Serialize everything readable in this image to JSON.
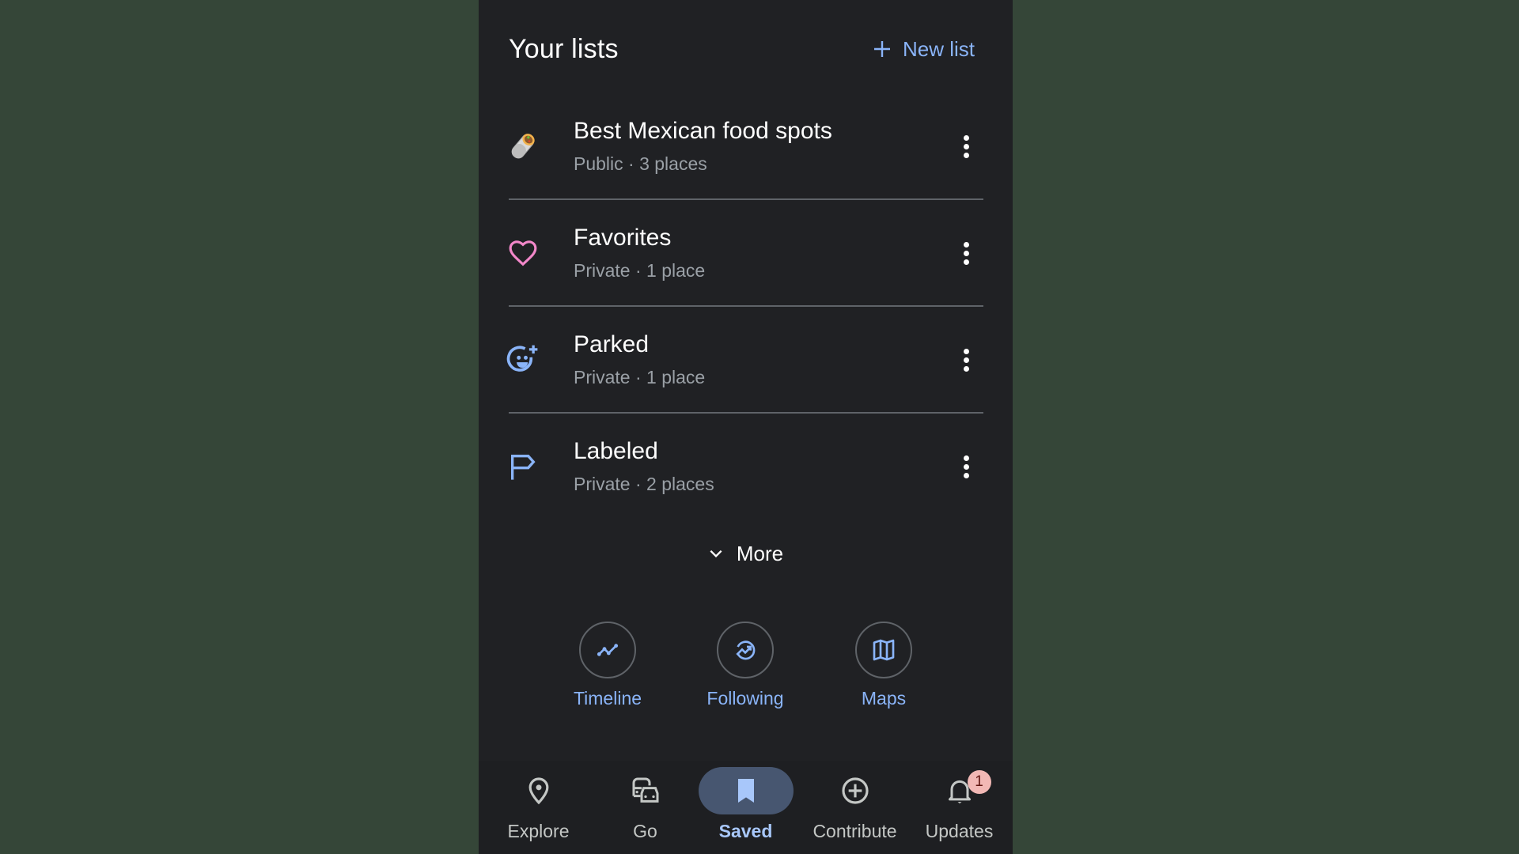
{
  "header": {
    "title": "Your lists",
    "new_list_label": "New list"
  },
  "lists": [
    {
      "name": "Best Mexican food spots",
      "meta": "Public · 3 places",
      "icon": "burrito-icon"
    },
    {
      "name": "Favorites",
      "meta": "Private · 1 place",
      "icon": "heart-icon"
    },
    {
      "name": "Parked",
      "meta": "Private · 1 place",
      "icon": "smiley-add-icon"
    },
    {
      "name": "Labeled",
      "meta": "Private · 2 places",
      "icon": "flag-icon"
    }
  ],
  "more_label": "More",
  "shortcuts": [
    {
      "label": "Timeline",
      "icon": "timeline-icon"
    },
    {
      "label": "Following",
      "icon": "following-icon"
    },
    {
      "label": "Maps",
      "icon": "map-icon"
    }
  ],
  "nav": {
    "items": [
      {
        "label": "Explore",
        "icon": "location-pin-icon"
      },
      {
        "label": "Go",
        "icon": "commute-icon"
      },
      {
        "label": "Saved",
        "icon": "bookmark-icon",
        "active": true
      },
      {
        "label": "Contribute",
        "icon": "add-circle-icon"
      },
      {
        "label": "Updates",
        "icon": "bell-icon",
        "badge": "1"
      }
    ]
  },
  "colors": {
    "accent": "#8ab4f8",
    "active_pill": "#475670",
    "heart": "#f287c9",
    "badge": "#f2b8b5",
    "background": "#202124"
  }
}
